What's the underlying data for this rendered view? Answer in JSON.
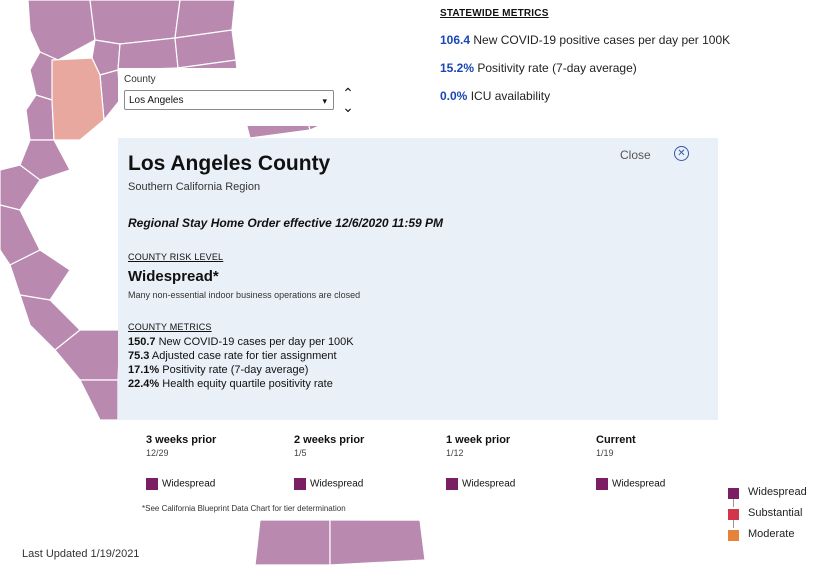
{
  "statewide": {
    "title": "STATEWIDE METRICS",
    "metrics": [
      {
        "value": "106.4",
        "text": "New COVID-19 positive cases per day per 100K"
      },
      {
        "value": "15.2%",
        "text": "Positivity rate (7-day average)"
      },
      {
        "value": "0.0%",
        "text": "ICU availability"
      }
    ]
  },
  "county_select": {
    "label": "County",
    "selected": "Los Angeles"
  },
  "panel": {
    "county_name": "Los Angeles County",
    "region": "Southern California Region",
    "order": "Regional Stay Home Order effective 12/6/2020 11:59 PM",
    "close_label": "Close",
    "risk_title": "COUNTY RISK LEVEL",
    "risk_level": "Widespread*",
    "risk_desc": "Many non-essential indoor business operations are closed",
    "metrics_title": "COUNTY METRICS",
    "metrics": [
      {
        "value": "150.7",
        "text": "New COVID-19 cases per day per 100K"
      },
      {
        "value": "75.3",
        "text": "Adjusted case rate for tier assignment"
      },
      {
        "value": "17.1%",
        "text": "Positivity rate (7-day average)"
      },
      {
        "value": "22.4%",
        "text": "Health equity quartile positivity rate"
      }
    ]
  },
  "timeline": [
    {
      "head": "3 weeks prior",
      "date": "12/29",
      "level": "Widespread"
    },
    {
      "head": "2 weeks prior",
      "date": "1/5",
      "level": "Widespread"
    },
    {
      "head": "1 week prior",
      "date": "1/12",
      "level": "Widespread"
    },
    {
      "head": "Current",
      "date": "1/19",
      "level": "Widespread"
    }
  ],
  "footnote": "*See California Blueprint Data Chart for tier determination",
  "legend": [
    {
      "label": "Widespread",
      "color": "#7b1e64"
    },
    {
      "label": "Substantial",
      "color": "#d1364b"
    },
    {
      "label": "Moderate",
      "color": "#e8823a"
    }
  ],
  "colors": {
    "widespread": "#b989b0",
    "selected_county": "#e8a8a0",
    "border": "#ffffff"
  },
  "last_updated": "Last Updated 1/19/2021"
}
